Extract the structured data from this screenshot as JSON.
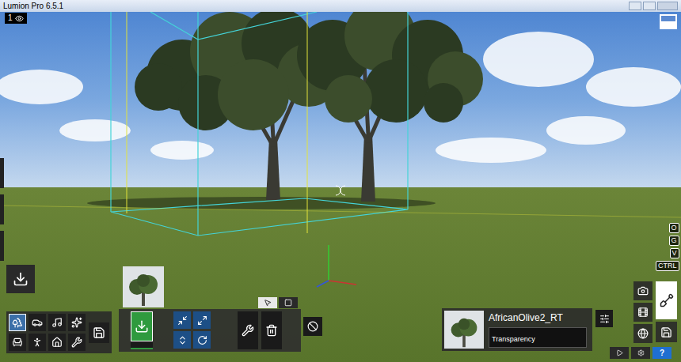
{
  "window": {
    "title": "Lumion Pro 6.5.1"
  },
  "viewport": {
    "camera_slot": "1"
  },
  "key_hints": [
    "O",
    "G",
    "V",
    "CTRL"
  ],
  "categories": [
    {
      "selected": true
    },
    {
      "selected": false
    },
    {
      "selected": false
    },
    {
      "selected": false
    },
    {
      "selected": false
    },
    {
      "selected": false
    },
    {
      "selected": false
    },
    {
      "selected": false
    }
  ],
  "placement_tabs": [
    {
      "selected": true
    },
    {
      "selected": false
    }
  ],
  "selected_object": {
    "name": "AfricanOlive2_RT",
    "property": "Transparency"
  },
  "modes": [
    {
      "selected": false
    },
    {
      "selected": false
    },
    {
      "selected": false
    },
    {
      "selected": true
    }
  ],
  "help": {
    "label": "?"
  }
}
